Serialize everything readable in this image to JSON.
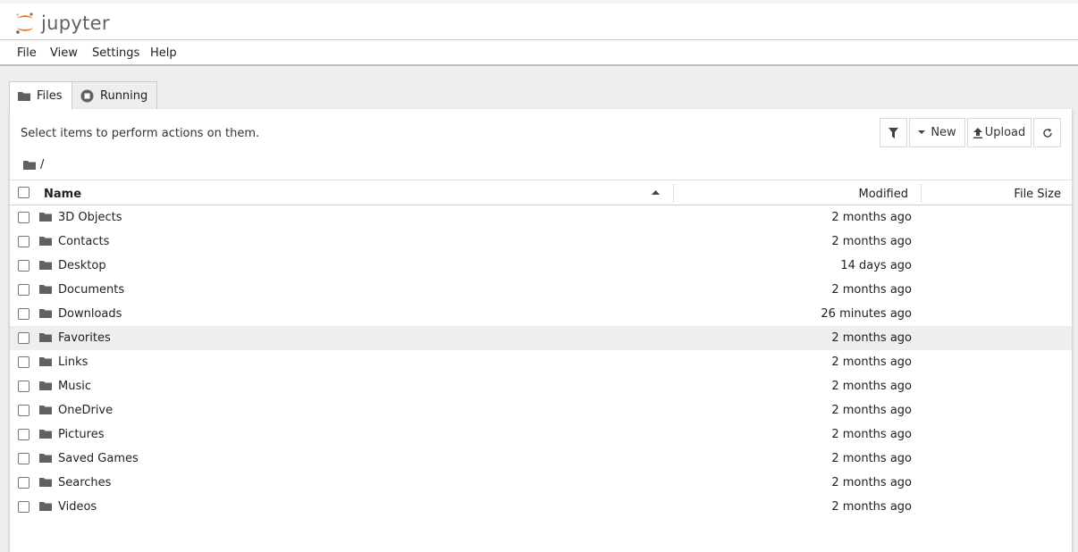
{
  "header": {
    "logo_text": "jupyter"
  },
  "menu": [
    {
      "label": "File"
    },
    {
      "label": "View"
    },
    {
      "label": "Settings"
    },
    {
      "label": "Help"
    }
  ],
  "tabs": [
    {
      "label": "Files",
      "icon": "folder-icon",
      "active": true
    },
    {
      "label": "Running",
      "icon": "stop-circle-icon",
      "active": false
    }
  ],
  "toolbar": {
    "hint": "Select items to perform actions on them.",
    "new_label": "New",
    "upload_label": "Upload"
  },
  "breadcrumb": {
    "path": "/"
  },
  "columns": {
    "name": "Name",
    "modified": "Modified",
    "size": "File Size"
  },
  "files": [
    {
      "name": "3D Objects",
      "modified": "2 months ago"
    },
    {
      "name": "Contacts",
      "modified": "2 months ago"
    },
    {
      "name": "Desktop",
      "modified": "14 days ago"
    },
    {
      "name": "Documents",
      "modified": "2 months ago"
    },
    {
      "name": "Downloads",
      "modified": "26 minutes ago"
    },
    {
      "name": "Favorites",
      "modified": "2 months ago"
    },
    {
      "name": "Links",
      "modified": "2 months ago"
    },
    {
      "name": "Music",
      "modified": "2 months ago"
    },
    {
      "name": "OneDrive",
      "modified": "2 months ago"
    },
    {
      "name": "Pictures",
      "modified": "2 months ago"
    },
    {
      "name": "Saved Games",
      "modified": "2 months ago"
    },
    {
      "name": "Searches",
      "modified": "2 months ago"
    },
    {
      "name": "Videos",
      "modified": "2 months ago"
    }
  ],
  "colors": {
    "brand_orange": "#f37726",
    "hover_row": "#eeeeee",
    "icon_gray": "#616161"
  }
}
